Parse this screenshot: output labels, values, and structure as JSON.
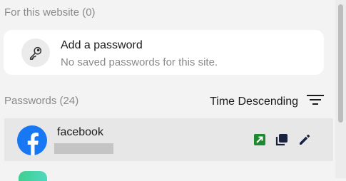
{
  "site_section": {
    "label": "For this website (0)",
    "card": {
      "title": "Add a password",
      "subtitle": "No saved passwords for this site.",
      "icon": "key-icon"
    }
  },
  "passwords_section": {
    "label": "Passwords (24)",
    "sort_label": "Time Descending",
    "sort_icon": "sort-lines-icon"
  },
  "entries": [
    {
      "name": "facebook",
      "icon": "facebook-logo-icon",
      "actions": [
        "open-site-icon",
        "copy-icon",
        "edit-icon"
      ]
    }
  ],
  "colors": {
    "background": "#f3f3f3",
    "card": "#ffffff",
    "row_selected": "#e7e7e7",
    "muted_text": "#8a8a8a",
    "facebook_blue": "#1877f2",
    "open_site_green": "#1e8a2f",
    "icon_dark": "#1b2140"
  }
}
